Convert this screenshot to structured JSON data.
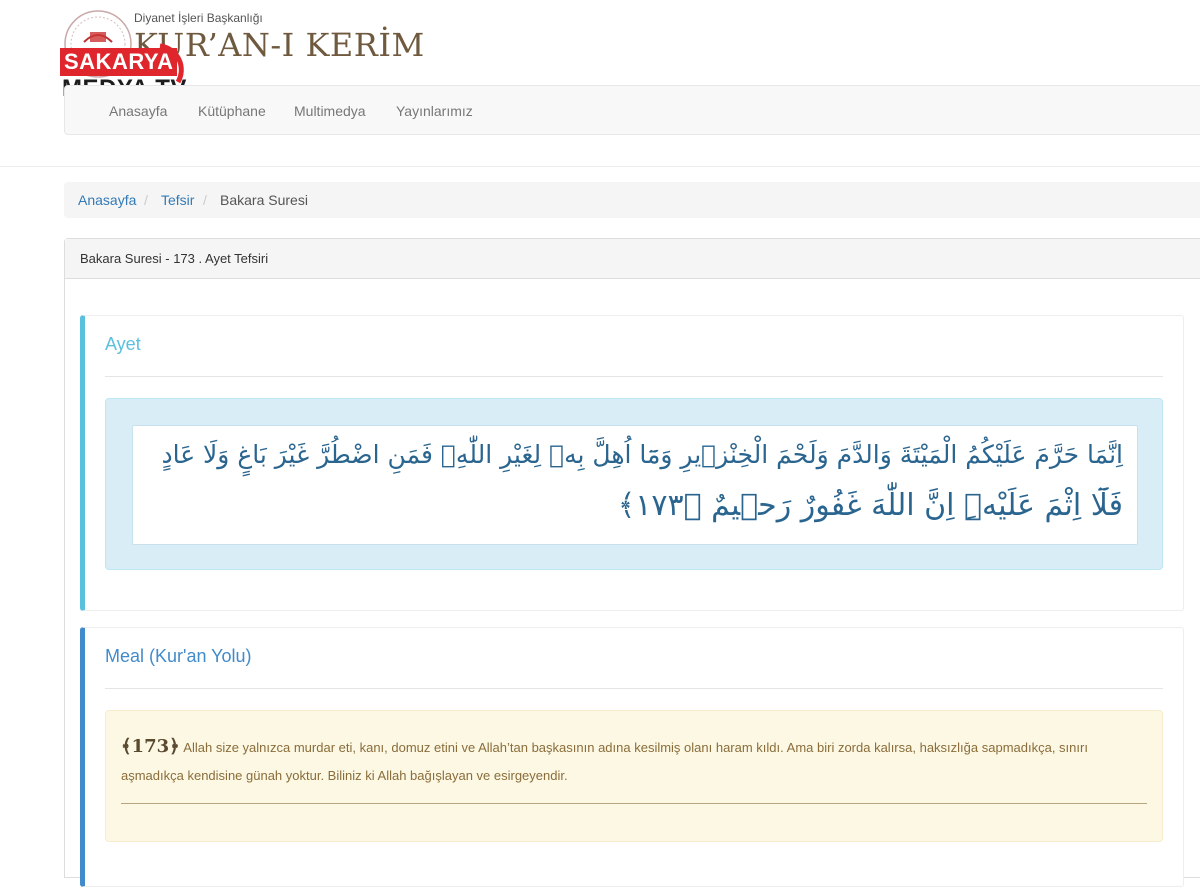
{
  "header": {
    "institution": "Diyanet İşleri Başkanlığı",
    "site_title": "KUR’AN-I KERİM"
  },
  "watermark": {
    "line1": "SAKARYA",
    "line2": "MEDYA TV"
  },
  "nav": {
    "items": [
      "Anasayfa",
      "Kütüphane",
      "Multimedya",
      "Yayınlarımız"
    ]
  },
  "breadcrumb": {
    "home": "Anasayfa",
    "section": "Tefsir",
    "current": "Bakara Suresi",
    "separator": "/"
  },
  "panel": {
    "heading": "Bakara Suresi - 173 . Ayet Tefsiri"
  },
  "ayet": {
    "title": "Ayet",
    "arabic_line1": "اِنَّمَا حَرَّمَ عَلَيْكُمُ الْمَيْتَةَ وَالدَّمَ وَلَحْمَ الْخِنْزٖيرِ وَمَٓا اُهِلَّ بِهٖ لِغَيْرِ اللّٰهِۚ فَمَنِ اضْطُرَّ غَيْرَ بَاغٍ وَلَا عَادٍ",
    "arabic_line2": "فَلَٓا اِثْمَ عَلَيْهِۜ اِنَّ اللّٰهَ غَفُورٌ رَحٖيمٌ ﴿١٧٣﴾"
  },
  "meal": {
    "title": "Meal (Kur'an Yolu)",
    "verse_number": "﴾173﴿",
    "text": "Allah size yalnızca murdar eti, kanı, domuz etini ve Allah’tan başkasının adına kesilmiş olanı haram kıldı. Ama biri zorda kalırsa, haksızlığa sapmadıkça, sınırı aşmadıkça kendisine günah yoktur. Biliniz ki Allah bağışlayan ve esirgeyendir."
  },
  "colors": {
    "info_accent": "#5bc0de",
    "primary_accent": "#428bca",
    "link": "#337ab7",
    "watermark_red": "#e0262d"
  }
}
